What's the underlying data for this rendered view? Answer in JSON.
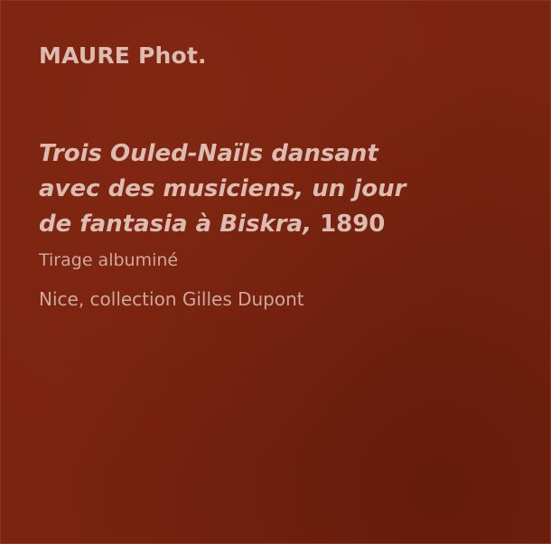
{
  "label": {
    "author": "MAURE Phot.",
    "title_lines": [
      "Trois Ouled-Naïls dansant",
      "avec des musiciens, un jour",
      "de fantasia à Biskra,"
    ],
    "year": "1890",
    "technique": "Tirage albuminé",
    "collection": "Nice, collection Gilles Dupont"
  },
  "colors": {
    "background": "#7b2410",
    "text": "#dcbcb1"
  }
}
